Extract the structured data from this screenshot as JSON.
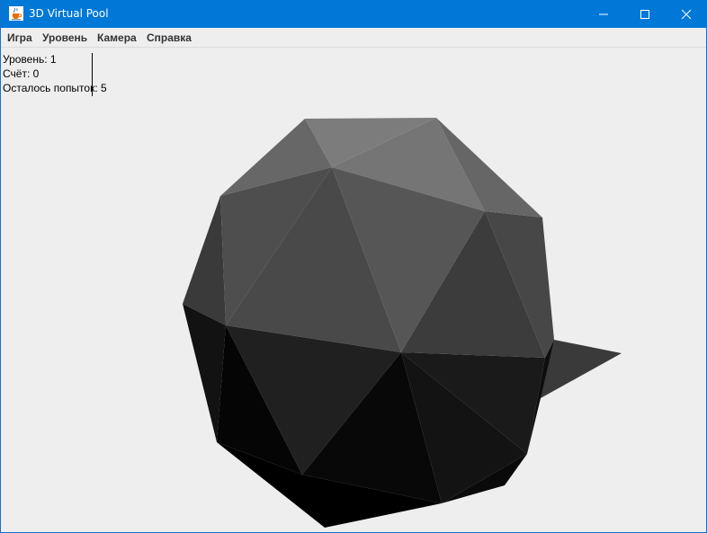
{
  "window": {
    "title": "3D Virtual Pool",
    "app_icon": "java-cup-icon",
    "controls": [
      "minimize-icon",
      "maximize-icon",
      "close-icon"
    ]
  },
  "menu": {
    "items": [
      {
        "label": "Игра"
      },
      {
        "label": "Уровень"
      },
      {
        "label": "Камера"
      },
      {
        "label": "Справка"
      }
    ]
  },
  "hud": {
    "level": "Уровень: 1",
    "score": "Счёт: 0",
    "attempts_left": "Осталось попыток: 5"
  },
  "colors": {
    "titlebar": "#0078d7",
    "background": "#eeeeee",
    "ball_light": "#7a7a7a",
    "ball_dark": "#0a0a0a"
  }
}
